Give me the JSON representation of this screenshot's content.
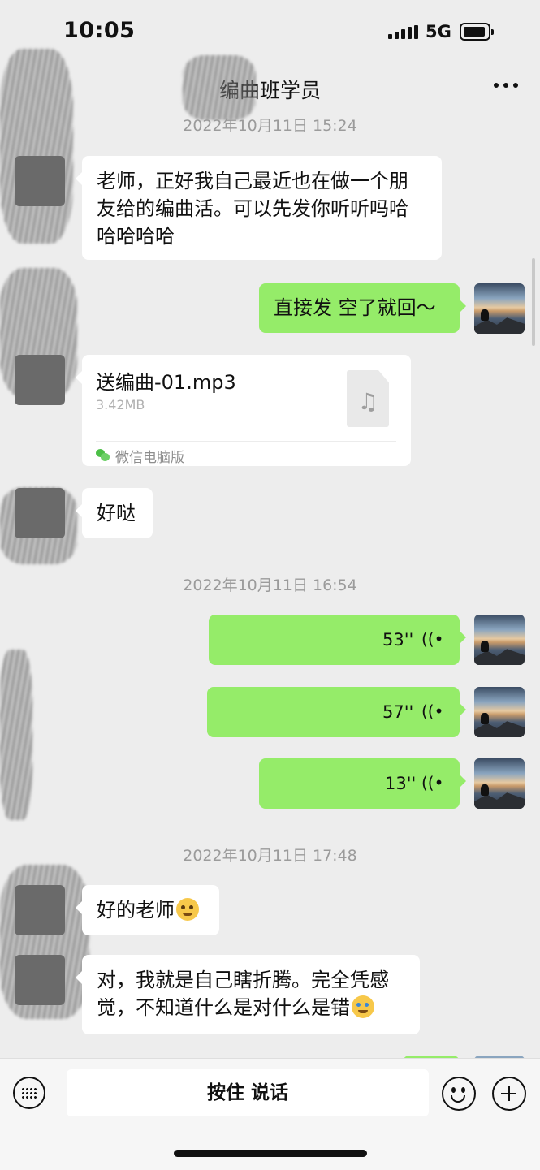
{
  "status_bar": {
    "time": "10:05",
    "network": "5G"
  },
  "header": {
    "title": "编曲班学员",
    "more_icon": "ellipsis-icon"
  },
  "messages": {
    "ts1": "2022年10月11日 15:24",
    "m1": "老师，正好我自己最近也在做一个朋友给的编曲活。可以先发你听听吗哈哈哈哈哈",
    "m2": "直接发 空了就回～",
    "file": {
      "name": "送编曲-01.mp3",
      "size": "3.42MB",
      "source": "微信电脑版"
    },
    "m3": "好哒",
    "ts2": "2022年10月11日 16:54",
    "voice1": "53''",
    "voice2": "57''",
    "voice3": "13''",
    "ts3": "2022年10月11日 17:48",
    "m4": "好的老师",
    "m5": "对，我就是自己瞎折腾。完全凭感觉，不知道什么是对什么是错"
  },
  "input_bar": {
    "talk_label": "按住 说话"
  },
  "colors": {
    "background": "#ededed",
    "sent_bubble": "#95ec69",
    "received_bubble": "#ffffff"
  }
}
